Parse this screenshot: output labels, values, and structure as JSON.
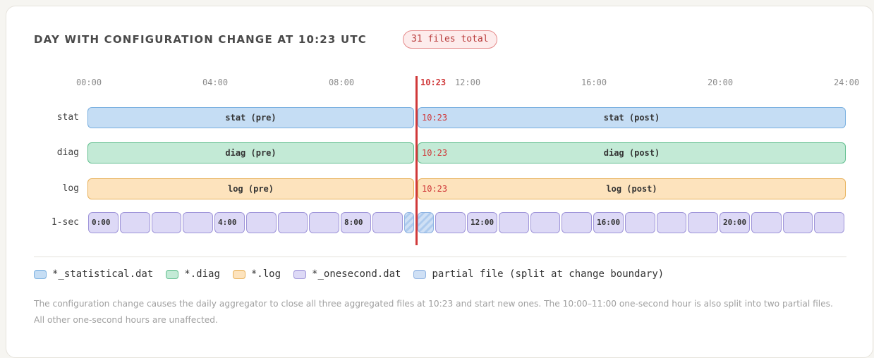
{
  "header": {
    "title": "DAY WITH CONFIGURATION CHANGE AT 10:23 UTC",
    "badge": "31 files total"
  },
  "change_time_label": "10:23",
  "axis_ticks": [
    "00:00",
    "04:00",
    "08:00",
    "12:00",
    "16:00",
    "20:00",
    "24:00"
  ],
  "rows": [
    {
      "label": "stat",
      "pre": "stat (pre)",
      "post": "stat (post)",
      "change_label": "10:23",
      "color": "#c5ddf4"
    },
    {
      "label": "diag",
      "pre": "diag (pre)",
      "post": "diag (post)",
      "change_label": "10:23",
      "color": "#c3ead6"
    },
    {
      "label": "log",
      "pre": "log (pre)",
      "post": "log (post)",
      "change_label": "10:23",
      "color": "#fde3bd"
    }
  ],
  "onesecond_row": {
    "label": "1-sec",
    "hour_labels": {
      "0": "0:00",
      "4": "4:00",
      "8": "8:00",
      "12": "12:00",
      "16": "16:00",
      "20": "20:00"
    },
    "partial_hour": 10,
    "color": "#ddd9f6"
  },
  "legend": [
    {
      "label": "*_statistical.dat",
      "color": "#c5ddf4",
      "border": "#7ab0e0"
    },
    {
      "label": "*.diag",
      "color": "#c3ead6",
      "border": "#62bf8f"
    },
    {
      "label": "*.log",
      "color": "#fde3bd",
      "border": "#e8b25c"
    },
    {
      "label": "*_onesecond.dat",
      "color": "#ddd9f6",
      "border": "#9f95d9"
    },
    {
      "label": "partial file (split at change boundary)",
      "color": "#cfe0f5",
      "border": "#8fb3e2"
    }
  ],
  "note": "The configuration change causes the daily aggregator to close all three aggregated files at 10:23 and start new ones. The 10:00–11:00 one-second hour is also split into two partial files. All other one-second hours are unaffected.",
  "colors": {
    "change": "#d0393a"
  }
}
